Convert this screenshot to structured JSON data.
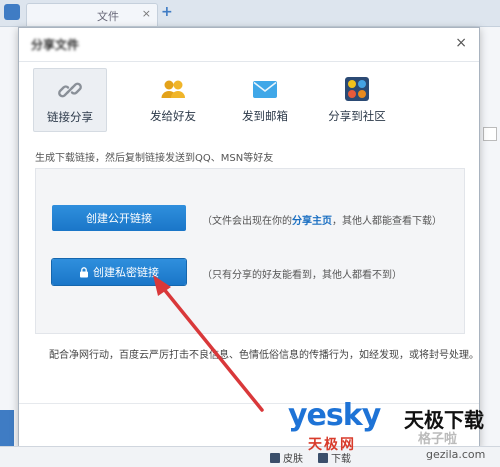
{
  "app": {
    "tab_title": "文件",
    "tab_close": "×",
    "new_tab": "+"
  },
  "dialog": {
    "title": "分享文件",
    "close": "×",
    "tabs": [
      {
        "label": "链接分享",
        "icon": "link-icon",
        "active": true
      },
      {
        "label": "发给好友",
        "icon": "friends-icon",
        "active": false
      },
      {
        "label": "发到邮箱",
        "icon": "mail-icon",
        "active": false
      },
      {
        "label": "分享到社区",
        "icon": "community-icon",
        "active": false
      }
    ],
    "hint": "生成下载链接，然后复制链接发送到QQ、MSN等好友",
    "public_button": "创建公开链接",
    "public_note_prefix": "（文件会出现在你的",
    "public_note_highlight": "分享主页",
    "public_note_suffix": "，其他人都能查看下载）",
    "private_button": "创建私密链接",
    "private_note": "（只有分享的好友能看到，其他人都看不到）",
    "footer_note": "配合净网行动，百度云严厉打击不良信息、色情低俗信息的传播行为，如经发现，或将封号处理。"
  },
  "bottom_bar": {
    "skin": "皮肤",
    "download": "下载"
  },
  "watermark": {
    "brand": "yesky",
    "brand_cn": "天极下载",
    "site": "天极网",
    "gzl": "格子啦",
    "gzl_url": "gezila.com"
  },
  "colors": {
    "button_blue": "#1a76c8",
    "highlight_blue": "#1a6fc2",
    "arrow_red": "#d9383a"
  }
}
